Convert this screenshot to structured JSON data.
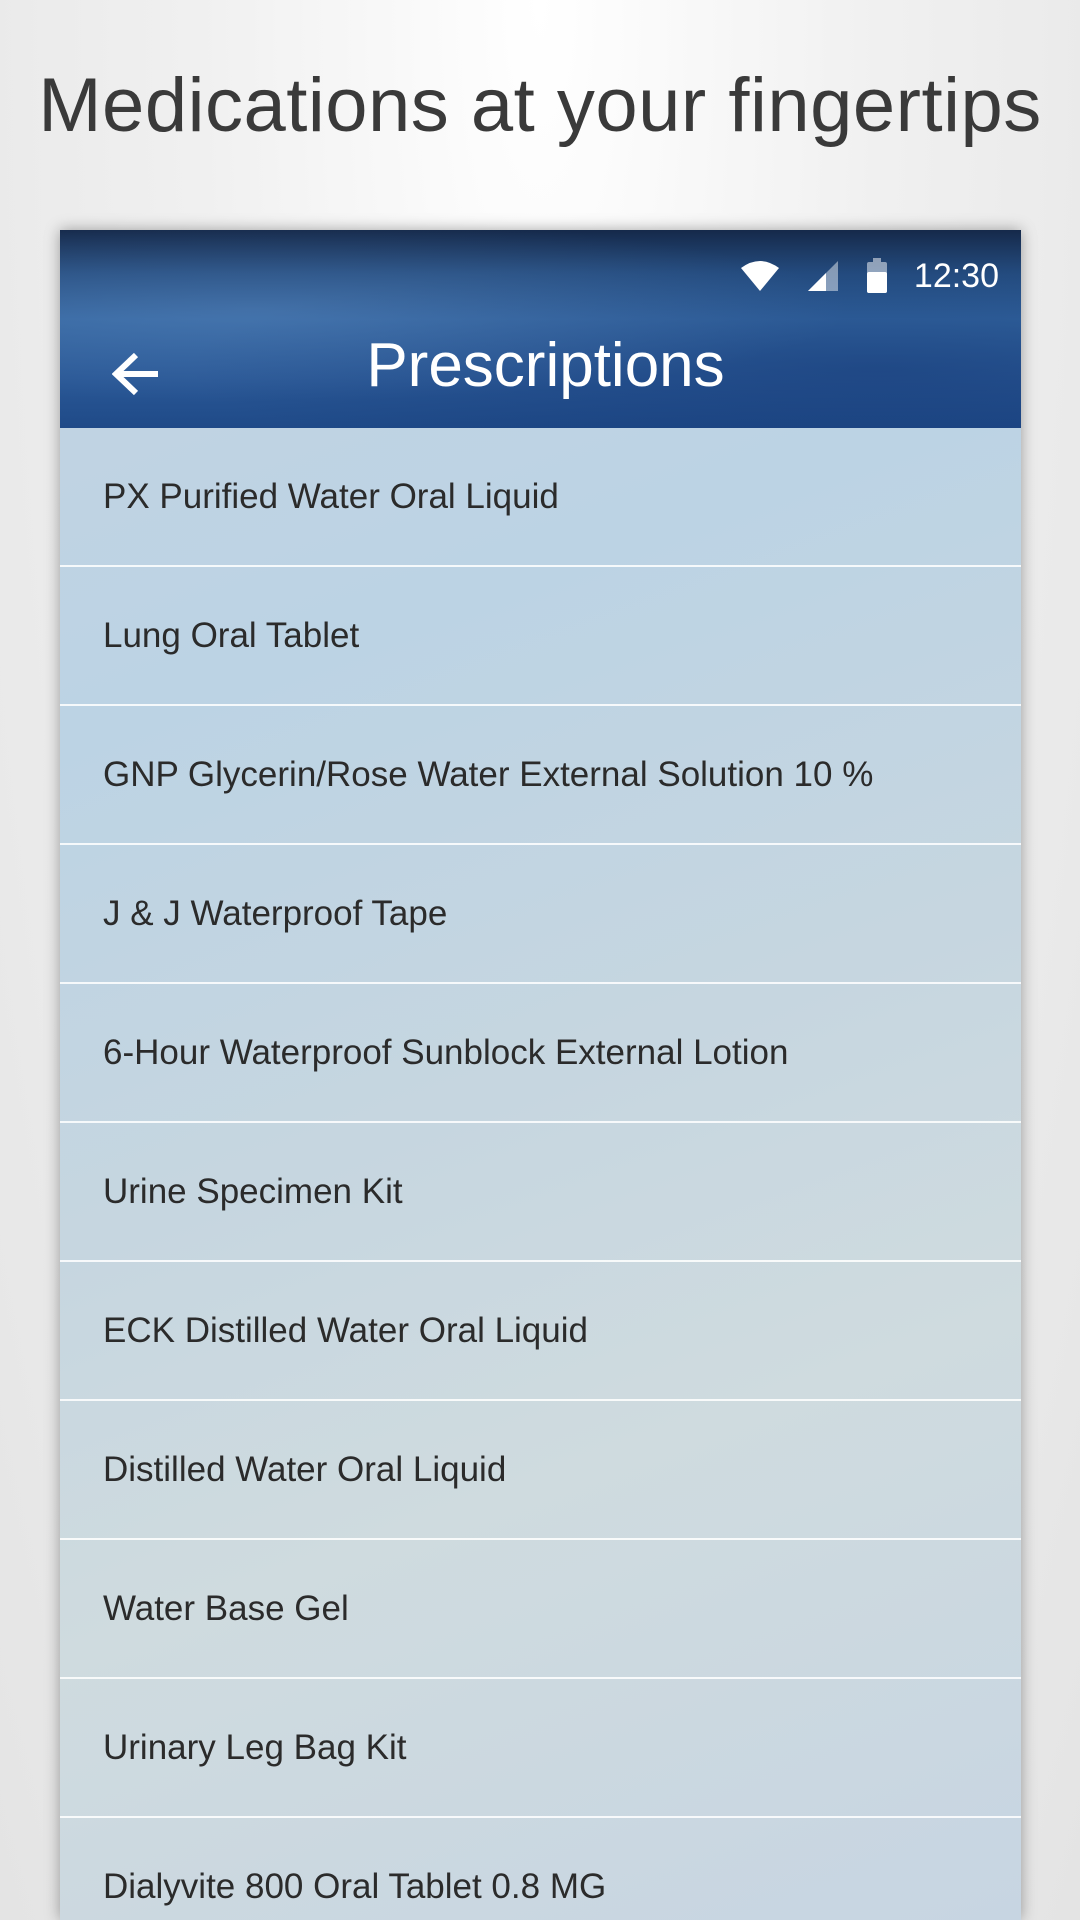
{
  "headline": "Medications at your fingertips",
  "status_bar": {
    "time": "12:30",
    "icons": [
      "wifi-icon",
      "cell-signal-icon",
      "battery-icon"
    ]
  },
  "app_bar": {
    "title": "Prescriptions",
    "back_icon": "arrow-left-icon"
  },
  "prescriptions": [
    "PX Purified Water Oral Liquid",
    "Lung Oral Tablet",
    "GNP Glycerin/Rose Water External Solution 10 %",
    "J & J Waterproof Tape",
    "6-Hour Waterproof Sunblock External Lotion",
    "Urine Specimen Kit",
    "ECK Distilled Water Oral Liquid",
    "Distilled Water Oral Liquid",
    "Water Base Gel",
    "Urinary Leg Bag Kit",
    "Dialyvite 800 Oral Tablet 0.8 MG"
  ],
  "colors": {
    "app_bar": "#2a5896",
    "list_background": "#c3d3e2",
    "text": "#2b2b2b"
  }
}
